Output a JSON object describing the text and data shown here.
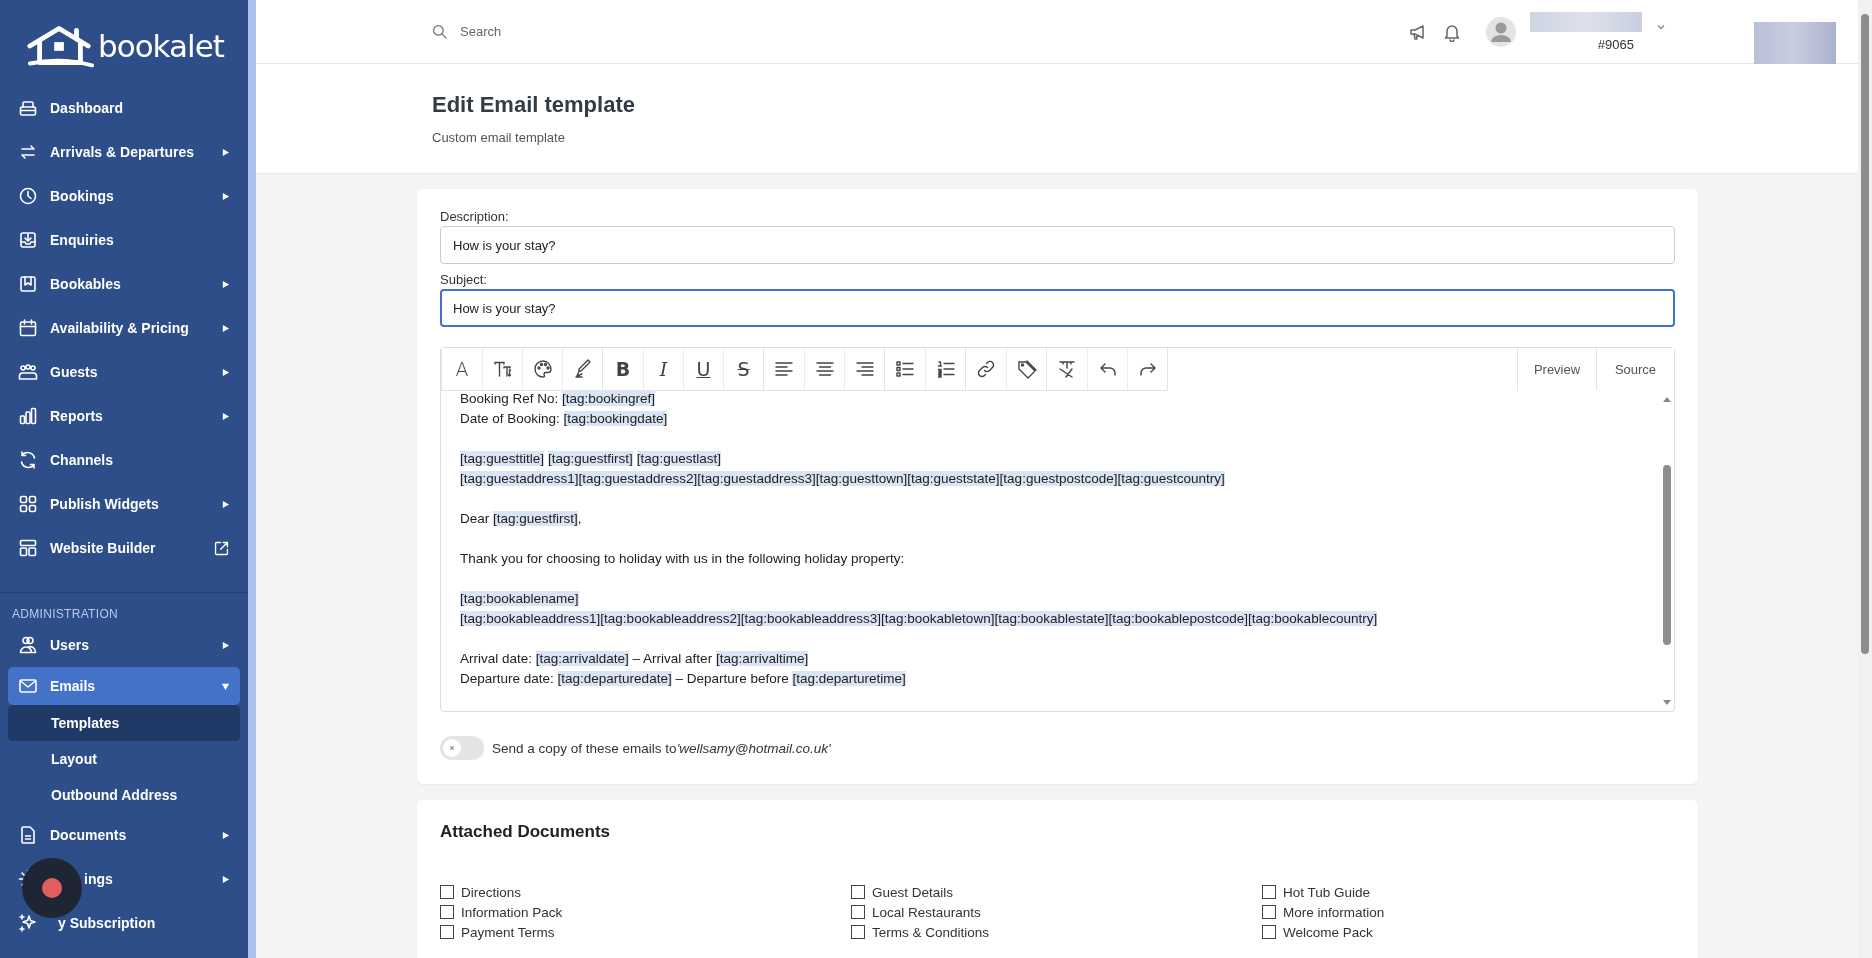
{
  "sidebar": {
    "logo": "bookalet",
    "items": [
      {
        "label": "Dashboard",
        "has_submenu": false,
        "external": false,
        "selected": false
      },
      {
        "label": "Arrivals & Departures",
        "has_submenu": true,
        "expanded": false,
        "external": false,
        "selected": false
      },
      {
        "label": "Bookings",
        "has_submenu": true,
        "expanded": false,
        "external": false,
        "selected": false
      },
      {
        "label": "Enquiries",
        "has_submenu": false,
        "external": false,
        "selected": false
      },
      {
        "label": "Bookables",
        "has_submenu": true,
        "expanded": false,
        "external": false,
        "selected": false
      },
      {
        "label": "Availability & Pricing",
        "has_submenu": true,
        "expanded": false,
        "external": false,
        "selected": false
      },
      {
        "label": "Guests",
        "has_submenu": true,
        "expanded": false,
        "external": false,
        "selected": false
      },
      {
        "label": "Reports",
        "has_submenu": true,
        "expanded": false,
        "external": false,
        "selected": false
      },
      {
        "label": "Channels",
        "has_submenu": false,
        "external": false,
        "selected": false
      },
      {
        "label": "Publish Widgets",
        "has_submenu": true,
        "expanded": false,
        "external": false,
        "selected": false
      },
      {
        "label": "Website Builder",
        "has_submenu": false,
        "external": true,
        "selected": false
      }
    ],
    "admin_section": {
      "title": "ADMINISTRATION",
      "items": [
        {
          "label": "Users",
          "has_submenu": true,
          "expanded": false,
          "external": false,
          "selected": false
        },
        {
          "label": "Emails",
          "has_submenu": true,
          "expanded": true,
          "external": false,
          "selected": true,
          "children": [
            {
              "label": "Templates",
              "selected": true
            },
            {
              "label": "Layout",
              "selected": false
            },
            {
              "label": "Outbound Address",
              "selected": false
            }
          ]
        },
        {
          "label": "Documents",
          "has_submenu": true,
          "expanded": false,
          "external": false,
          "selected": false
        },
        {
          "label": "ings",
          "has_submenu": true,
          "expanded": false,
          "external": false,
          "selected": false
        },
        {
          "label": "y Subscription",
          "has_submenu": false,
          "external": false,
          "selected": false
        }
      ]
    }
  },
  "header": {
    "search": {
      "placeholder": "Search"
    },
    "account_number": "#9065"
  },
  "page": {
    "title": "Edit Email template",
    "subtitle": "Custom email template"
  },
  "form": {
    "description": {
      "label": "Description:",
      "value": "How is your stay?",
      "focused": false
    },
    "subject": {
      "label": "Subject:",
      "value": "How is your stay?",
      "focused": true
    },
    "toolbar": [
      [
        {
          "kind": "font",
          "glyph": "A"
        },
        {
          "kind": "font-size"
        },
        {
          "kind": "palette"
        },
        {
          "kind": "brush"
        }
      ],
      [
        {
          "kind": "bold",
          "glyph": "B"
        },
        {
          "kind": "italic",
          "glyph": "I"
        },
        {
          "kind": "underline",
          "glyph": "U"
        },
        {
          "kind": "strike",
          "glyph": "S"
        }
      ],
      [
        {
          "kind": "align-left"
        },
        {
          "kind": "align-center"
        },
        {
          "kind": "align-right"
        }
      ],
      [
        {
          "kind": "bullet-list"
        },
        {
          "kind": "numbered-list"
        }
      ],
      [
        {
          "kind": "link"
        },
        {
          "kind": "tag"
        }
      ],
      [
        {
          "kind": "clear-format"
        },
        {
          "kind": "undo"
        },
        {
          "kind": "redo"
        }
      ]
    ],
    "view_buttons": [
      "Preview",
      "Source"
    ],
    "editor_lines": [
      {
        "kind": "text",
        "segments": [
          {
            "text": "Booking Ref No: ",
            "tag": false
          },
          {
            "text": "[tag:bookingref]",
            "tag": true
          }
        ]
      },
      {
        "kind": "text",
        "segments": [
          {
            "text": "Date of Booking: ",
            "tag": false
          },
          {
            "text": "[tag:bookingdate]",
            "tag": true
          }
        ]
      },
      {
        "kind": "blank"
      },
      {
        "kind": "text",
        "segments": [
          {
            "text": "[tag:guesttitle]",
            "tag": true
          },
          {
            "text": "[tag:guestfirst]",
            "tag": true,
            "gap_before": true
          },
          {
            "text": "[tag:guestlast]",
            "tag": true,
            "gap_before": true
          }
        ]
      },
      {
        "kind": "text",
        "segments": [
          {
            "text": "[tag:guestaddress1][tag:guestaddress2][tag:guestaddress3][tag:guesttown][tag:gueststate][tag:guestpostcode][tag:guestcountry]",
            "tag": true
          }
        ]
      },
      {
        "kind": "blank"
      },
      {
        "kind": "text",
        "segments": [
          {
            "text": "Dear ",
            "tag": false
          },
          {
            "text": "[tag:guestfirst]",
            "tag": true
          },
          {
            "text": ",",
            "tag": false
          }
        ]
      },
      {
        "kind": "blank"
      },
      {
        "kind": "text",
        "segments": [
          {
            "text": "Thank you for choosing to holiday with us in the following holiday property:",
            "tag": false
          }
        ]
      },
      {
        "kind": "blank"
      },
      {
        "kind": "text",
        "segments": [
          {
            "text": "[tag:bookablename]",
            "tag": true
          }
        ]
      },
      {
        "kind": "text",
        "segments": [
          {
            "text": "[tag:bookableaddress1][tag:bookableaddress2][tag:bookableaddress3][tag:bookabletown][tag:bookablestate][tag:bookablepostcode][tag:bookablecountry]",
            "tag": true
          }
        ]
      },
      {
        "kind": "blank"
      },
      {
        "kind": "text",
        "segments": [
          {
            "text": "Arrival date: ",
            "tag": false
          },
          {
            "text": "[tag:arrivaldate]",
            "tag": true
          },
          {
            "text": " – Arrival after ",
            "tag": false
          },
          {
            "text": "[tag:arrivaltime]",
            "tag": true
          }
        ]
      },
      {
        "kind": "text",
        "segments": [
          {
            "text": "Departure date: ",
            "tag": false
          },
          {
            "text": "[tag:departuredate]",
            "tag": true
          },
          {
            "text": " – Departure before ",
            "tag": false
          },
          {
            "text": "[tag:departuretime]",
            "tag": true
          }
        ]
      }
    ],
    "copy_toggle": {
      "on": false,
      "label": "Send a copy of these emails to",
      "email": "'wellsamy@hotmail.co.uk'"
    }
  },
  "attached_documents": {
    "title": "Attached Documents",
    "columns": [
      [
        {
          "label": "Directions",
          "checked": false
        },
        {
          "label": "Information Pack",
          "checked": false
        },
        {
          "label": "Payment Terms",
          "checked": false
        }
      ],
      [
        {
          "label": "Guest Details",
          "checked": false
        },
        {
          "label": "Local Restaurants",
          "checked": false
        },
        {
          "label": "Terms & Conditions",
          "checked": false
        }
      ],
      [
        {
          "label": "Hot Tub Guide",
          "checked": false
        },
        {
          "label": "More information",
          "checked": false
        },
        {
          "label": "Welcome Pack",
          "checked": false
        }
      ]
    ]
  }
}
